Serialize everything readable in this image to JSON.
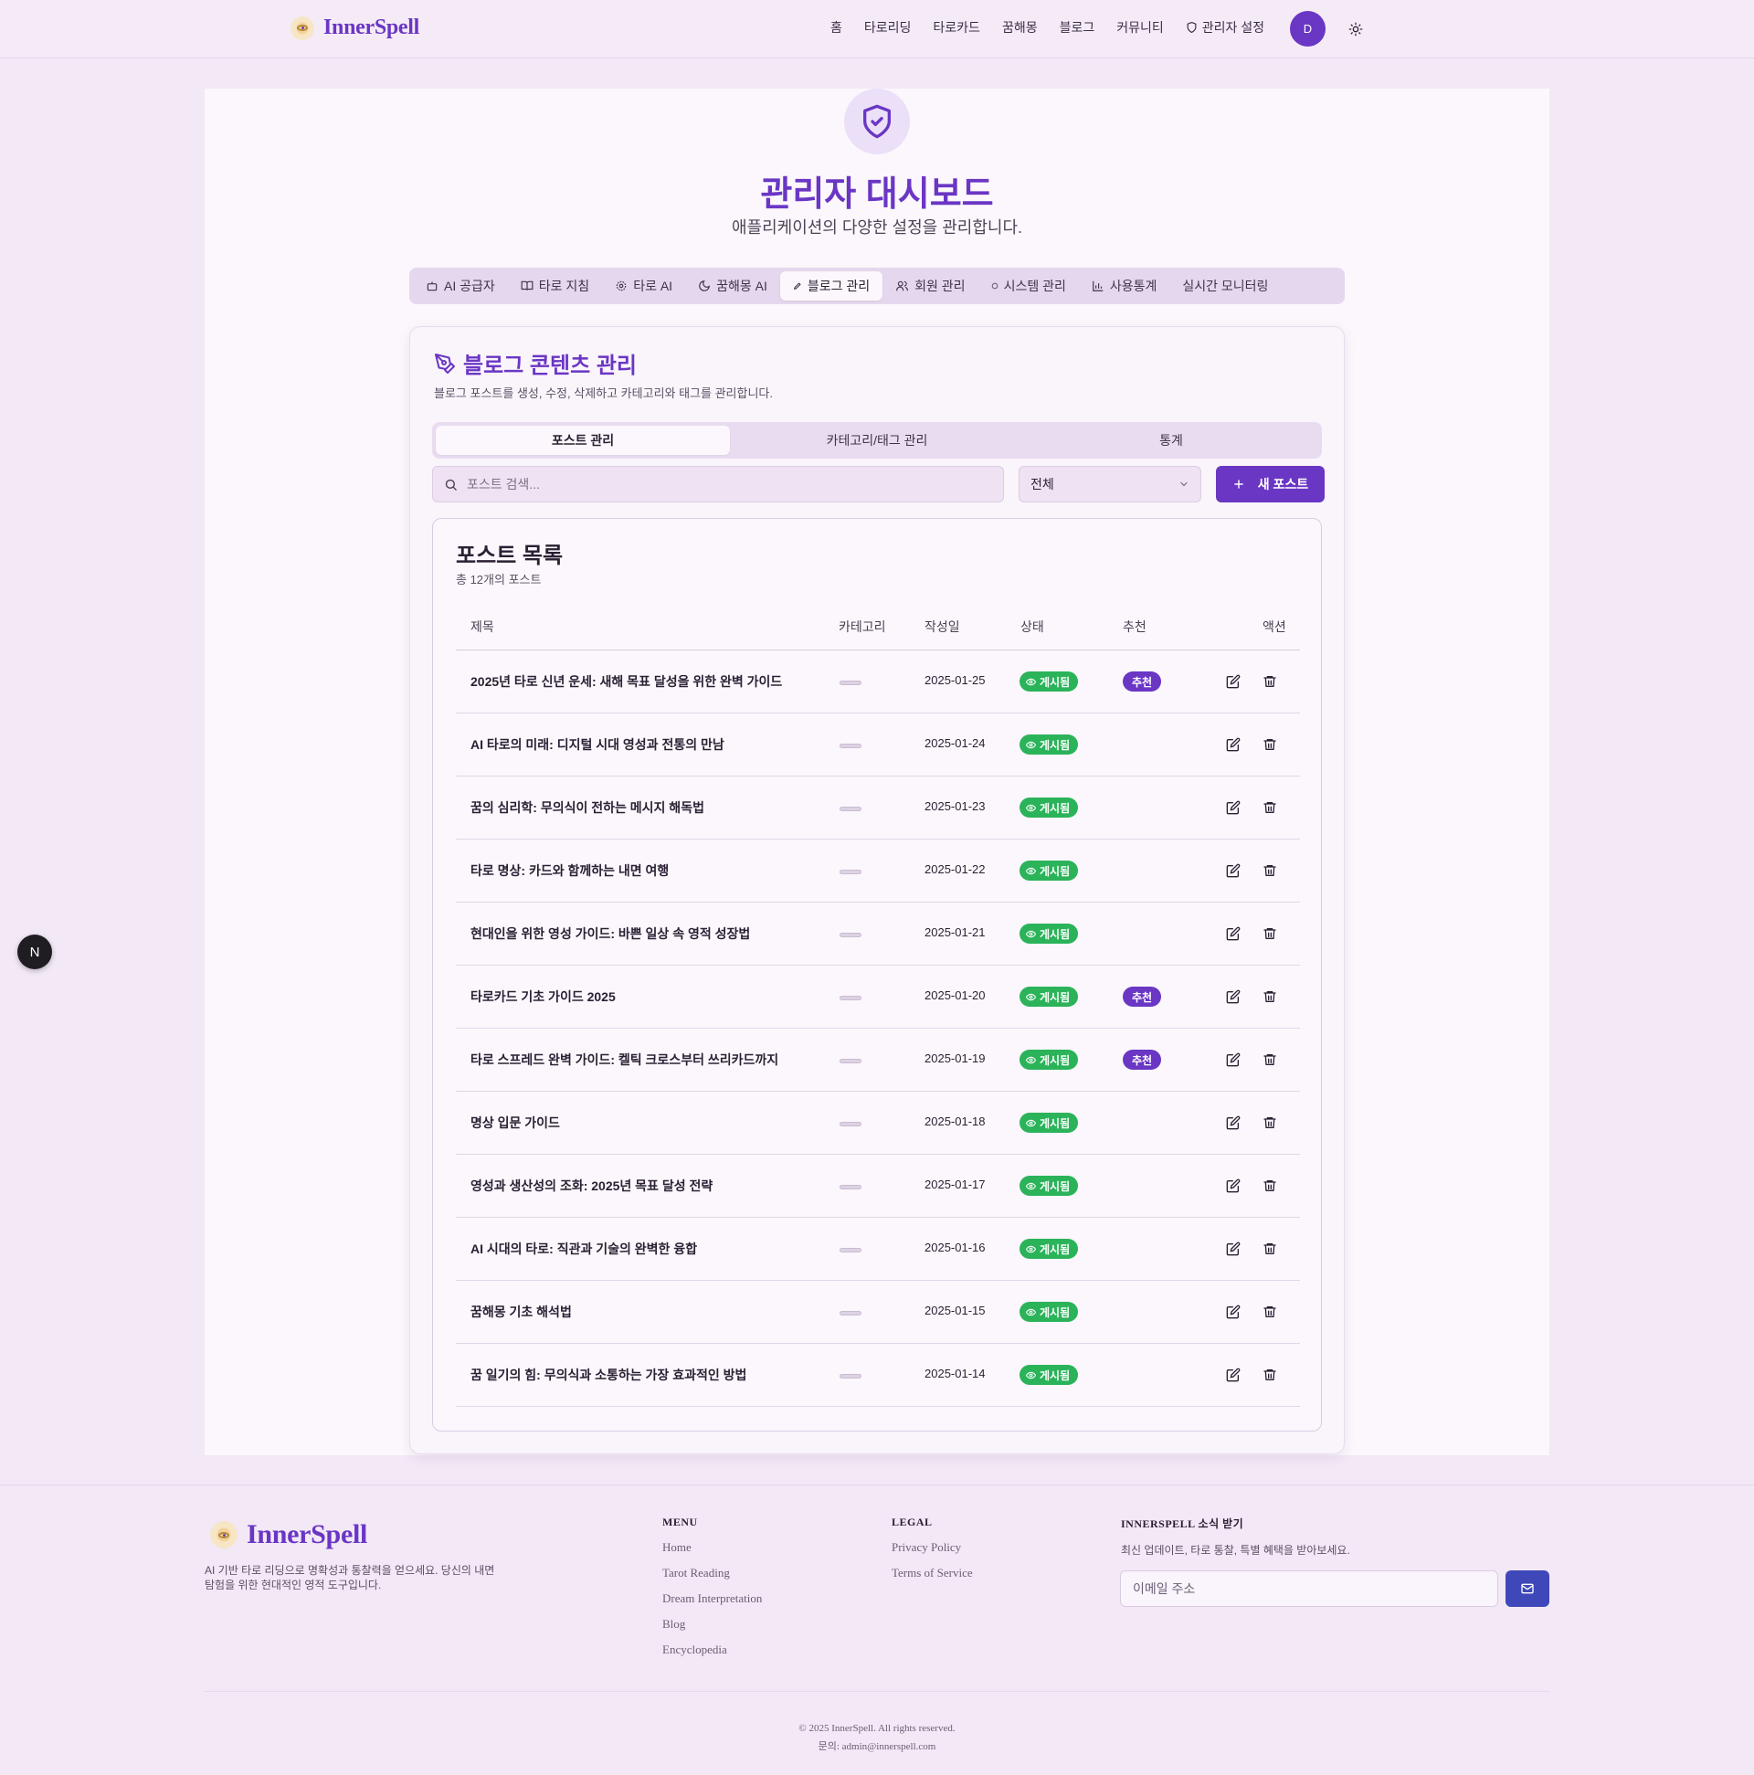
{
  "app": {
    "name": "InnerSpell"
  },
  "nav": {
    "items": [
      "홈",
      "타로리딩",
      "타로카드",
      "꿈해몽",
      "블로그",
      "커뮤니티"
    ],
    "admin_label": "관리자 설정",
    "avatar_initial": "D"
  },
  "page": {
    "title": "관리자 대시보드",
    "subtitle": "애플리케이션의 다양한 설정을 관리합니다."
  },
  "admin_tabs": [
    {
      "label": "AI 공급자",
      "icon": "bot-icon"
    },
    {
      "label": "타로 지침",
      "icon": "book-icon"
    },
    {
      "label": "타로 AI",
      "icon": "gear-icon"
    },
    {
      "label": "꿈해몽 AI",
      "icon": "moon-icon"
    },
    {
      "label": "블로그 관리",
      "icon": "pen-icon",
      "active": true
    },
    {
      "label": "회원 관리",
      "icon": "users-icon"
    },
    {
      "label": "시스템 관리",
      "icon": "dot-icon"
    },
    {
      "label": "사용통계",
      "icon": "bar-chart-icon"
    },
    {
      "label": "실시간 모니터링",
      "icon": ""
    }
  ],
  "blog": {
    "title": "블로그 콘텐츠 관리",
    "description": "블로그 포스트를 생성, 수정, 삭제하고 카테고리와 태그를 관리합니다.",
    "sub_tabs": [
      "포스트 관리",
      "카테고리/태그 관리",
      "통계"
    ],
    "search_placeholder": "포스트 검색...",
    "filter_value": "전체",
    "new_post_label": "새 포스트",
    "list_title": "포스트 목록",
    "list_count": "총 12개의 포스트",
    "columns": [
      "제목",
      "카테고리",
      "작성일",
      "상태",
      "추천",
      "액션"
    ],
    "status_published": "게시됨",
    "featured_label": "추천",
    "posts": [
      {
        "title": "2025년 타로 신년 운세: 새해 목표 달성을 위한 완벽 가이드",
        "date": "2025-01-25",
        "featured": true
      },
      {
        "title": "AI 타로의 미래: 디지털 시대 영성과 전통의 만남",
        "date": "2025-01-24",
        "featured": false
      },
      {
        "title": "꿈의 심리학: 무의식이 전하는 메시지 해독법",
        "date": "2025-01-23",
        "featured": false
      },
      {
        "title": "타로 명상: 카드와 함께하는 내면 여행",
        "date": "2025-01-22",
        "featured": false
      },
      {
        "title": "현대인을 위한 영성 가이드: 바쁜 일상 속 영적 성장법",
        "date": "2025-01-21",
        "featured": false
      },
      {
        "title": "타로카드 기초 가이드 2025",
        "date": "2025-01-20",
        "featured": true
      },
      {
        "title": "타로 스프레드 완벽 가이드: 켈틱 크로스부터 쓰리카드까지",
        "date": "2025-01-19",
        "featured": true
      },
      {
        "title": "명상 입문 가이드",
        "date": "2025-01-18",
        "featured": false
      },
      {
        "title": "영성과 생산성의 조화: 2025년 목표 달성 전략",
        "date": "2025-01-17",
        "featured": false
      },
      {
        "title": "AI 시대의 타로: 직관과 기술의 완벽한 융합",
        "date": "2025-01-16",
        "featured": false
      },
      {
        "title": "꿈해몽 기초 해석법",
        "date": "2025-01-15",
        "featured": false
      },
      {
        "title": "꿈 일기의 힘: 무의식과 소통하는 가장 효과적인 방법",
        "date": "2025-01-14",
        "featured": false
      }
    ]
  },
  "floating_badge": "N",
  "footer": {
    "brand": "InnerSpell",
    "description": "AI 기반 타로 리딩으로 명확성과 통찰력을 얻으세요. 당신의 내면 탐험을 위한 현대적인 영적 도구입니다.",
    "menu_heading": "MENU",
    "menu_links": [
      "Home",
      "Tarot Reading",
      "Dream Interpretation",
      "Blog",
      "Encyclopedia"
    ],
    "legal_heading": "LEGAL",
    "legal_links": [
      "Privacy Policy",
      "Terms of Service"
    ],
    "subscribe_heading": "INNERSPELL 소식 받기",
    "subscribe_desc": "최신 업데이트, 타로 통찰, 특별 혜택을 받아보세요.",
    "email_placeholder": "이메일 주소",
    "copyright": "© 2025 InnerSpell. All rights reserved.",
    "contact": "문의: admin@innerspell.com"
  },
  "colors": {
    "brand": "#6a36c4",
    "published": "#2bb35a",
    "send_button": "#3f48b8",
    "background": "#f3e8f6"
  }
}
